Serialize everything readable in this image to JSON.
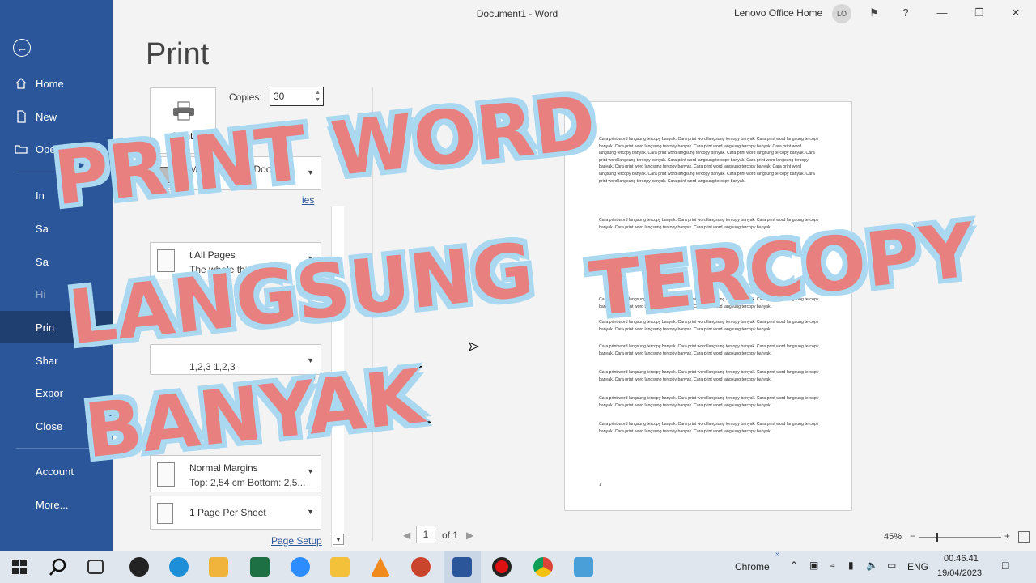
{
  "window": {
    "title": "Document1  -  Word",
    "user": "Lenovo Office Home",
    "avatar": "LO"
  },
  "nav": {
    "items": [
      {
        "label": "Home",
        "icon": "home-icon"
      },
      {
        "label": "New",
        "icon": "new-doc-icon"
      },
      {
        "label": "Open",
        "icon": "folder-icon"
      },
      {
        "label": "In"
      },
      {
        "label": "Sa"
      },
      {
        "label": "Sa"
      },
      {
        "label": "Hi"
      },
      {
        "label": "Prin"
      },
      {
        "label": "Shar"
      },
      {
        "label": "Expor"
      },
      {
        "label": "Close"
      },
      {
        "label": "Account"
      },
      {
        "label": "More..."
      }
    ]
  },
  "print": {
    "heading": "Print",
    "button_label": "Print",
    "copies_label": "Copies:",
    "copies_value": "30",
    "printer_name": "Microsoft XPS Doc",
    "printer_props_link": "ies",
    "pages_title": "t All Pages",
    "pages_sub": "The whole thi",
    "collate_sub": "1,2,3    1,2,3",
    "margins_title": "Normal Margins",
    "margins_sub": "Top: 2,54 cm Bottom: 2,5...",
    "per_sheet": "1 Page Per Sheet",
    "page_setup_link": "Page Setup"
  },
  "preview": {
    "paragraph_text": "Cara print word langsung tercopy banyak. Cara print word langsung tercopy banyak. Cara print word langsung tercopy banyak. Cara print word langsung tercopy banyak. Cara print word langsung tercopy banyak.",
    "long_paragraph": "Cara print word langsung tercopy banyak. Cara print word langsung tercopy banyak. Cara print word langsung tercopy banyak. Cara print word langsung tercopy banyak. Cara print word langsung tercopy banyak. Cara print word langsung tercopy banyak. Cara print word langsung tercopy banyak. Cara print word langsung tercopy banyak. Cara print word langsung tercopy banyak. Cara print word langsung tercopy banyak. Cara print word langsung tercopy banyak. Cara print word langsung tercopy banyak. Cara print word langsung tercopy banyak. Cara print word langsung tercopy banyak. Cara print word langsung tercopy banyak. Cara print word langsung tercopy banyak. Cara print word langsung tercopy banyak. Cara print word langsung tercopy banyak.",
    "page_number": "1",
    "current_page": "1",
    "of_pages": "of 1",
    "zoom": "45%"
  },
  "overlay": {
    "line1": "PRINT WORD",
    "line2a": "LANGSUNG",
    "line2b": "TERCOPY",
    "line3": "BANYAK"
  },
  "taskbar": {
    "app_label": "Chrome",
    "lang": "ENG",
    "time": "00.46.41",
    "date": "19/04/2023"
  }
}
